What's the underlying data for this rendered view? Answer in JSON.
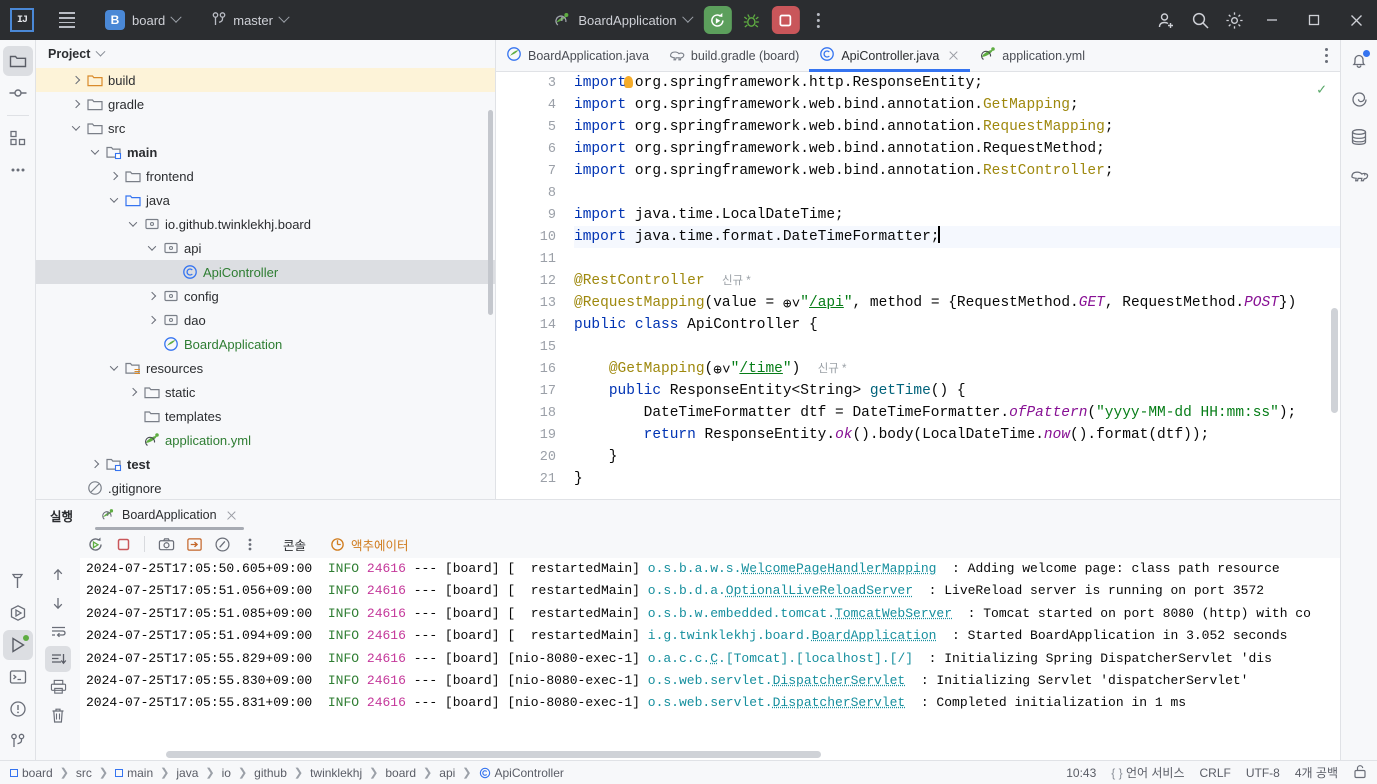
{
  "titlebar": {
    "logo": "IJ",
    "menu_icon": "hamburger-menu-icon",
    "project_badge": "B",
    "project_name": "board",
    "branch_icon": "git-branch-icon",
    "branch_name": "master",
    "run_config_icon": "spring-boot-icon",
    "run_config_name": "BoardApplication",
    "run_button": "rerun-icon",
    "debug_button": "debug-icon",
    "stop_button": "stop-icon",
    "more_button": "more-vertical-icon",
    "invite_icon": "add-user-icon",
    "search_icon": "search-icon",
    "settings_icon": "gear-icon",
    "minimize": "minimize-icon",
    "maximize": "maximize-icon",
    "close": "close-icon"
  },
  "left_stripe": [
    {
      "name": "project-tool-window",
      "icon": "folder-icon",
      "selected": true
    },
    {
      "name": "commit-tool-window",
      "icon": "commit-icon",
      "selected": false
    },
    {
      "name": "structure-tool-window",
      "icon": "structure-icon",
      "selected": false
    },
    {
      "name": "more-tool-windows",
      "icon": "ellipsis-icon",
      "selected": false
    }
  ],
  "left_stripe_bottom": [
    {
      "name": "build-tool-window",
      "icon": "hammer-icon",
      "selected": false
    },
    {
      "name": "services-tool-window",
      "icon": "services-play-icon",
      "selected": false
    },
    {
      "name": "run-tool-window",
      "icon": "run-play-icon",
      "selected": true
    },
    {
      "name": "terminal-tool-window",
      "icon": "terminal-icon",
      "selected": false
    },
    {
      "name": "problems-tool-window",
      "icon": "warning-circle-icon",
      "selected": false
    },
    {
      "name": "git-tool-window",
      "icon": "git-branch-icon",
      "selected": false
    }
  ],
  "right_stripe": [
    {
      "name": "notifications",
      "icon": "bell-icon",
      "badge": true
    },
    {
      "name": "spring-tool-window",
      "icon": "spring-spiral-icon",
      "badge": false
    },
    {
      "name": "database-tool-window",
      "icon": "database-icon",
      "badge": false
    },
    {
      "name": "gradle-tool-window",
      "icon": "gradle-elephant-icon",
      "badge": false
    }
  ],
  "project_panel": {
    "title": "Project",
    "tree": [
      {
        "label": "build",
        "indent": 1,
        "arrow": "closed",
        "icon": "folder-orange",
        "style": "",
        "state": "highlight"
      },
      {
        "label": "gradle",
        "indent": 1,
        "arrow": "closed",
        "icon": "folder-gray",
        "style": "",
        "state": ""
      },
      {
        "label": "src",
        "indent": 1,
        "arrow": "open",
        "icon": "folder-gray",
        "style": "",
        "state": ""
      },
      {
        "label": "main",
        "indent": 2,
        "arrow": "open",
        "icon": "folder-module",
        "style": "bold",
        "state": ""
      },
      {
        "label": "frontend",
        "indent": 3,
        "arrow": "closed",
        "icon": "folder-gray",
        "style": "",
        "state": ""
      },
      {
        "label": "java",
        "indent": 3,
        "arrow": "open",
        "icon": "folder-blue",
        "style": "",
        "state": ""
      },
      {
        "label": "io.github.twinklekhj.board",
        "indent": 4,
        "arrow": "open",
        "icon": "package",
        "style": "",
        "state": ""
      },
      {
        "label": "api",
        "indent": 5,
        "arrow": "open",
        "icon": "package",
        "style": "",
        "state": ""
      },
      {
        "label": "ApiController",
        "indent": 6,
        "arrow": "none",
        "icon": "class",
        "style": "green",
        "state": "selected"
      },
      {
        "label": "config",
        "indent": 5,
        "arrow": "closed",
        "icon": "package",
        "style": "",
        "state": ""
      },
      {
        "label": "dao",
        "indent": 5,
        "arrow": "closed",
        "icon": "package",
        "style": "",
        "state": ""
      },
      {
        "label": "BoardApplication",
        "indent": 5,
        "arrow": "none",
        "icon": "spring-class",
        "style": "green",
        "state": ""
      },
      {
        "label": "resources",
        "indent": 3,
        "arrow": "open",
        "icon": "folder-res",
        "style": "",
        "state": ""
      },
      {
        "label": "static",
        "indent": 4,
        "arrow": "closed",
        "icon": "folder-gray",
        "style": "",
        "state": ""
      },
      {
        "label": "templates",
        "indent": 4,
        "arrow": "none",
        "icon": "folder-gray",
        "style": "",
        "state": ""
      },
      {
        "label": "application.yml",
        "indent": 4,
        "arrow": "none",
        "icon": "spring-yml",
        "style": "green",
        "state": ""
      },
      {
        "label": "test",
        "indent": 2,
        "arrow": "closed",
        "icon": "folder-module",
        "style": "bold",
        "state": ""
      },
      {
        "label": ".gitignore",
        "indent": 1,
        "arrow": "none",
        "icon": "gitignore",
        "style": "",
        "state": ""
      }
    ]
  },
  "editor": {
    "tabs": [
      {
        "label": "BoardApplication.java",
        "icon": "spring-class-icon",
        "active": false,
        "closable": false
      },
      {
        "label": "build.gradle (board)",
        "icon": "gradle-file-icon",
        "active": false,
        "closable": false
      },
      {
        "label": "ApiController.java",
        "icon": "java-class-icon",
        "active": true,
        "closable": true
      },
      {
        "label": "application.yml",
        "icon": "spring-yml-icon",
        "active": false,
        "closable": false
      }
    ],
    "options_icon": "more-vertical-icon",
    "inspection_status": "check-mark-ok",
    "first_visible_line": 3,
    "caret_line": 10,
    "lines": [
      {
        "n": 3,
        "html": "<span class=\"kw\">import</span> org.springframework.http.ResponseEntity;"
      },
      {
        "n": 4,
        "html": "<span class=\"kw\">import</span> org.springframework.web.bind.annotation.<span class=\"ann\">GetMapping</span>;"
      },
      {
        "n": 5,
        "html": "<span class=\"kw\">import</span> org.springframework.web.bind.annotation.<span class=\"ann\">RequestMapping</span>;"
      },
      {
        "n": 6,
        "html": "<span class=\"kw\">import</span> org.springframework.web.bind.annotation.RequestMethod;"
      },
      {
        "n": 7,
        "html": "<span class=\"kw\">import</span> org.springframework.web.bind.annotation.<span class=\"ann\">RestController</span>;"
      },
      {
        "n": 8,
        "html": ""
      },
      {
        "n": 9,
        "html": "<span class=\"kw\">import</span> java.time.LocalDateTime;"
      },
      {
        "n": 10,
        "html": "<span class=\"kw\">import</span> java.time.format.DateTimeFormatter;<span class=\"caret\"></span>"
      },
      {
        "n": 11,
        "html": ""
      },
      {
        "n": 12,
        "html": "<span class=\"ann\">@RestController</span>  <span class=\"inlay\">신규 *</span>"
      },
      {
        "n": 13,
        "html": "<span class=\"ann\">@RequestMapping</span>(value = <span class=\"globe\">⊕˅</span><span class=\"str\">\"</span><span class=\"urlstr\">/api</span><span class=\"str\">\"</span>, method = {RequestMethod.<span class=\"stat\">GET</span>, RequestMethod.<span class=\"stat\">POST</span>})"
      },
      {
        "n": 14,
        "html": "<span class=\"kw\">public class</span> ApiController {"
      },
      {
        "n": 15,
        "html": ""
      },
      {
        "n": 16,
        "html": "    <span class=\"ann\">@GetMapping</span>(<span class=\"globe\">⊕˅</span><span class=\"str\">\"</span><span class=\"urlstr\">/time</span><span class=\"str\">\"</span>)  <span class=\"inlay\">신규 *</span>"
      },
      {
        "n": 17,
        "html": "    <span class=\"kw\">public</span> ResponseEntity&lt;String&gt; <span class=\"meth\">getTime</span>() {"
      },
      {
        "n": 18,
        "html": "        DateTimeFormatter dtf = DateTimeFormatter.<span class=\"stat\">ofPattern</span>(<span class=\"str\">\"yyyy-MM-dd HH:mm:ss\"</span>);"
      },
      {
        "n": 19,
        "html": "        <span class=\"kw\">return</span> ResponseEntity.<span class=\"stat\">ok</span>().body(LocalDateTime.<span class=\"stat\">now</span>().format(dtf));"
      },
      {
        "n": 20,
        "html": "    }"
      },
      {
        "n": 21,
        "html": "}"
      }
    ],
    "gutter_marks": [
      {
        "n": 14,
        "icon": "bean-no-entry-icon"
      },
      {
        "n": 17,
        "icon": "url-mapping-icon"
      }
    ]
  },
  "run_panel": {
    "title": "실행",
    "tab_label": "BoardApplication",
    "tab_icon": "spring-boot-icon",
    "tab_close": "close-icon",
    "toolbar": [
      {
        "name": "rerun-button",
        "icon": "rerun-icon"
      },
      {
        "name": "stop-button",
        "icon": "stop-square-icon"
      },
      {
        "name": "camera-button",
        "icon": "camera-icon"
      },
      {
        "name": "thread-dump-button",
        "icon": "arrow-into-box-icon"
      },
      {
        "name": "profiler-button",
        "icon": "gauge-icon"
      },
      {
        "name": "more-button",
        "icon": "more-vertical-icon"
      }
    ],
    "view_tabs": [
      {
        "label": "콘솔",
        "name": "tab-console",
        "accent": false
      },
      {
        "label": "액추에이터",
        "name": "tab-actuator",
        "accent": true,
        "icon": "actuator-icon"
      }
    ],
    "console_stripe": [
      {
        "name": "scroll-up-button",
        "icon": "arrow-up-icon",
        "selected": false
      },
      {
        "name": "scroll-down-button",
        "icon": "arrow-down-icon",
        "selected": false
      },
      {
        "name": "soft-wrap-button",
        "icon": "soft-wrap-icon",
        "selected": false
      },
      {
        "name": "scroll-to-end-button",
        "icon": "scroll-to-end-icon",
        "selected": true
      },
      {
        "name": "print-button",
        "icon": "printer-icon",
        "selected": false
      },
      {
        "name": "clear-all-button",
        "icon": "trash-icon",
        "selected": false
      }
    ],
    "log_lines": [
      {
        "ts": "2024-07-25T17:05:50.605+09:00",
        "level": "INFO",
        "pid": "24616",
        "app": "board",
        "thread": "restartedMain",
        "cls": "o.s.b.a.w.s.",
        "cls_u": "WelcomePageHandlerMapping",
        "msg": ": Adding welcome page: class path resource "
      },
      {
        "ts": "2024-07-25T17:05:51.056+09:00",
        "level": "INFO",
        "pid": "24616",
        "app": "board",
        "thread": "restartedMain",
        "cls": "o.s.b.d.a.",
        "cls_u": "OptionalLiveReloadServer",
        "msg": ": LiveReload server is running on port 3572"
      },
      {
        "ts": "2024-07-25T17:05:51.085+09:00",
        "level": "INFO",
        "pid": "24616",
        "app": "board",
        "thread": "restartedMain",
        "cls": "o.s.b.w.embedded.tomcat.",
        "cls_u": "TomcatWebServer",
        "msg": ": Tomcat started on port 8080 (http) with co"
      },
      {
        "ts": "2024-07-25T17:05:51.094+09:00",
        "level": "INFO",
        "pid": "24616",
        "app": "board",
        "thread": "restartedMain",
        "cls": "i.g.twinklekhj.board.",
        "cls_u": "BoardApplication",
        "msg": ": Started BoardApplication in 3.052 seconds"
      },
      {
        "ts": "2024-07-25T17:05:55.829+09:00",
        "level": "INFO",
        "pid": "24616",
        "app": "board",
        "thread": "nio-8080-exec-1",
        "cls": "o.a.c.c.",
        "cls_u": "C",
        "cls_tail": ".[Tomcat].[localhost].[/]",
        "msg": ": Initializing Spring DispatcherServlet 'dis"
      },
      {
        "ts": "2024-07-25T17:05:55.830+09:00",
        "level": "INFO",
        "pid": "24616",
        "app": "board",
        "thread": "nio-8080-exec-1",
        "cls": "o.s.web.servlet.",
        "cls_u": "DispatcherServlet",
        "msg": ": Initializing Servlet 'dispatcherServlet'"
      },
      {
        "ts": "2024-07-25T17:05:55.831+09:00",
        "level": "INFO",
        "pid": "24616",
        "app": "board",
        "thread": "nio-8080-exec-1",
        "cls": "o.s.web.servlet.",
        "cls_u": "DispatcherServlet",
        "msg": ": Completed initialization in 1 ms"
      }
    ]
  },
  "status_bar": {
    "breadcrumb": [
      {
        "label": "board",
        "icon": "module-icon"
      },
      {
        "label": "src",
        "icon": ""
      },
      {
        "label": "main",
        "icon": "module-icon"
      },
      {
        "label": "java",
        "icon": ""
      },
      {
        "label": "io",
        "icon": ""
      },
      {
        "label": "github",
        "icon": ""
      },
      {
        "label": "twinklekhj",
        "icon": ""
      },
      {
        "label": "board",
        "icon": ""
      },
      {
        "label": "api",
        "icon": ""
      },
      {
        "label": "ApiController",
        "icon": "class-icon"
      }
    ],
    "caret_position": "10:43",
    "language_services": "언어 서비스",
    "line_separator": "CRLF",
    "encoding": "UTF-8",
    "indent": "4개 공백",
    "lock_icon": "unlocked-padlock-icon"
  },
  "colors": {
    "titlebar_bg": "#2b2d30",
    "panel_bg": "#f7f8fa",
    "editor_bg": "#ffffff",
    "accent_blue": "#3574f0",
    "run_green": "#5c9f5c",
    "stop_red": "#c9565a",
    "keyword_blue": "#0033b3",
    "annotation_gold": "#9e880d",
    "string_green": "#067d17",
    "static_purple": "#871094",
    "log_class_teal": "#168f9e",
    "log_pid_magenta": "#c4379a",
    "highlight_row": "#fdf3d8",
    "selected_row": "#dcdee2"
  }
}
